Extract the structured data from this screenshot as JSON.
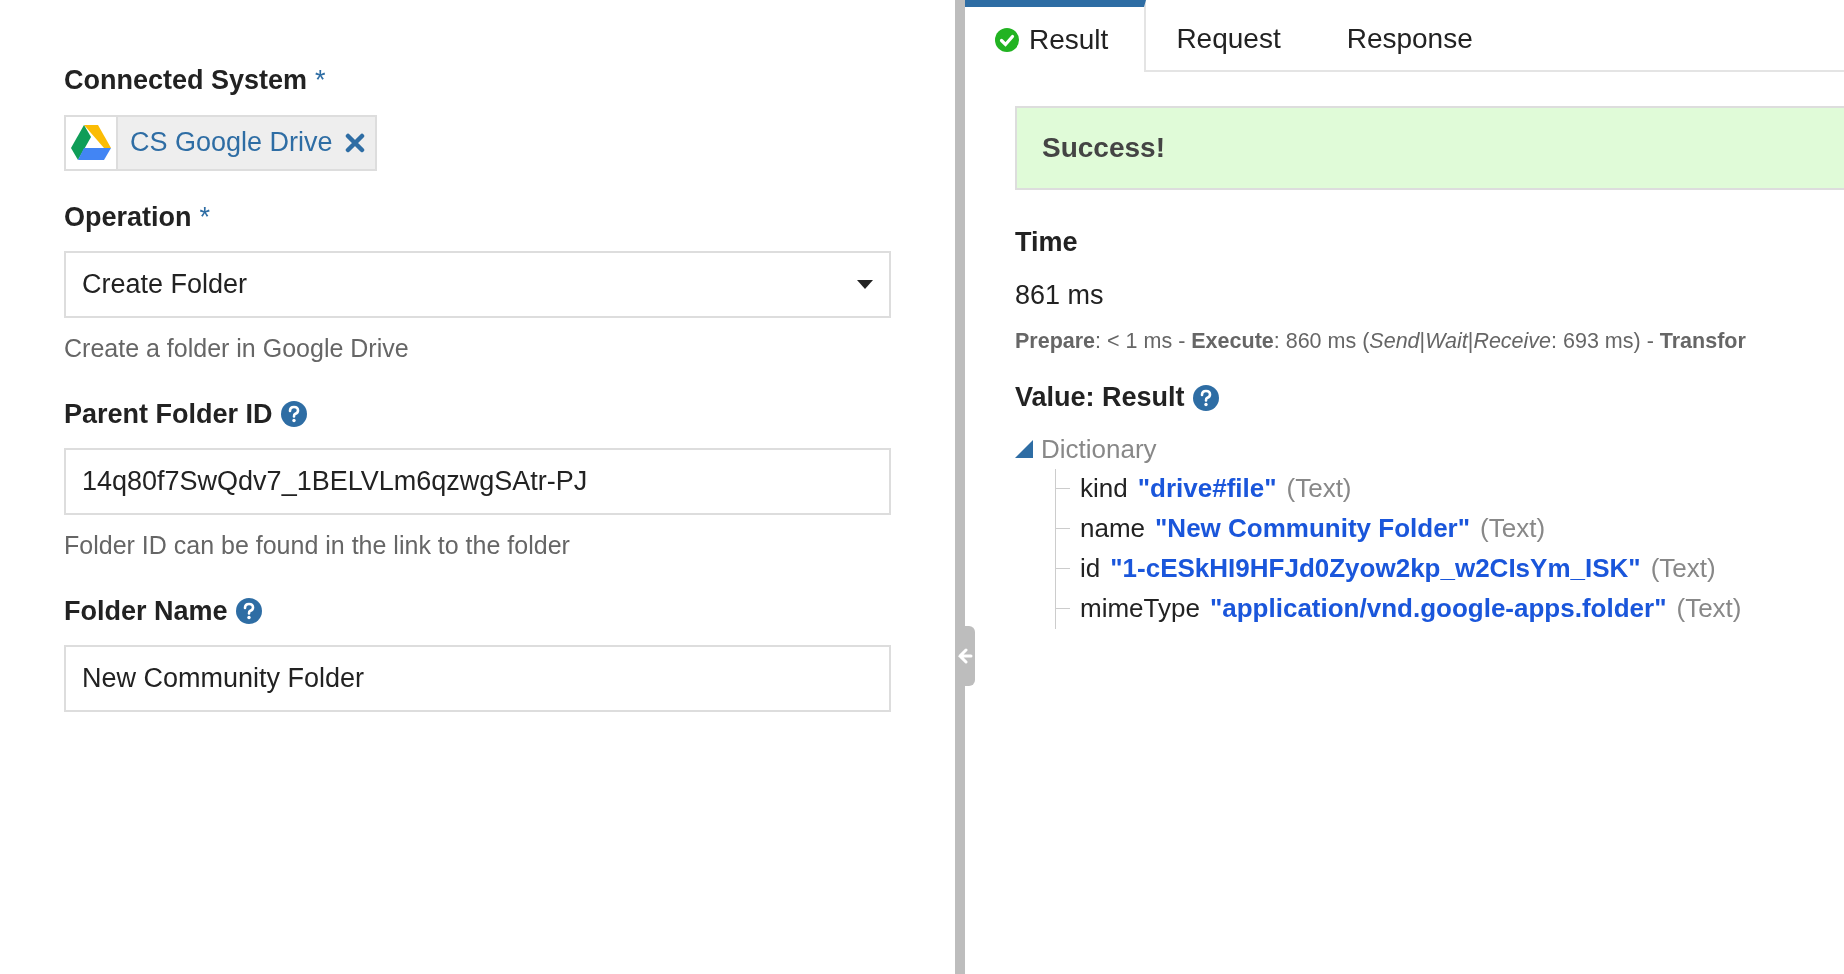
{
  "form": {
    "fields": [
      {
        "kind": "chip",
        "label": "Connected System",
        "required_mark": "*",
        "help_icon": false,
        "value": "CS Google Drive"
      },
      {
        "kind": "select",
        "label": "Operation",
        "required_mark": "*",
        "help_icon": false,
        "value": "Create Folder",
        "hint": "Create a folder in Google Drive"
      },
      {
        "kind": "text",
        "label": "Parent Folder ID",
        "help_icon": true,
        "value": "14q80f7SwQdv7_1BELVLm6qzwgSAtr-PJ",
        "hint": "Folder ID can be found in the link to the folder"
      },
      {
        "kind": "text",
        "label": "Folder Name",
        "help_icon": true,
        "value": "New Community Folder"
      }
    ]
  },
  "result_panel": {
    "tabs": [
      {
        "label": "Result",
        "selected": true,
        "success_icon": true
      },
      {
        "label": "Request",
        "selected": false,
        "success_icon": false
      },
      {
        "label": "Response",
        "selected": false,
        "success_icon": false
      }
    ],
    "alert": "Success!",
    "time_heading": "Time",
    "time_value": "861 ms",
    "time_breakdown": "**Prepare**: < 1 ms - **Execute**: 860 ms (*Send*|*Wait*|*Receive*: 693 ms) - **Transfor**",
    "value_heading": "Value: Result",
    "tree": {
      "label": "Dictionary",
      "expanded": true,
      "children": [
        {
          "key": "kind",
          "value": "\"drive#file\"",
          "type": "(Text)"
        },
        {
          "key": "name",
          "value": "\"New Community Folder\"",
          "type": "(Text)"
        },
        {
          "key": "id",
          "value": "\"1-cESkHI9HFJd0Zyow2kp_w2CIsYm_ISK\"",
          "type": "(Text)"
        },
        {
          "key": "mimeType",
          "value": "\"application/vnd.google-apps.folder\"",
          "type": "(Text)"
        }
      ]
    }
  }
}
